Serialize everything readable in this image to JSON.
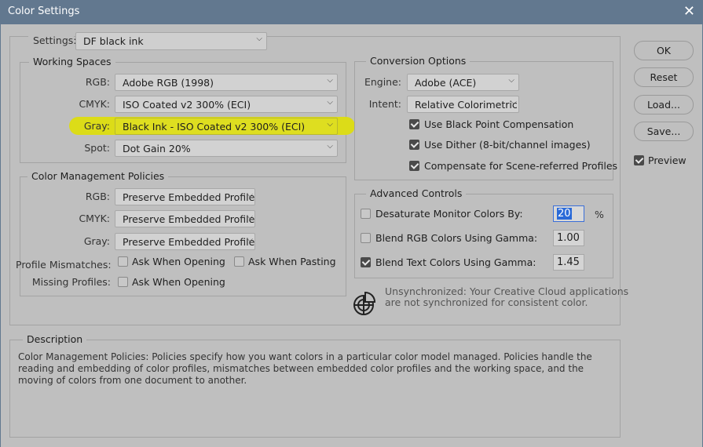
{
  "window": {
    "title": "Color Settings",
    "close_icon": "close-icon"
  },
  "settings": {
    "label": "Settings:",
    "value": "DF black ink"
  },
  "working_spaces": {
    "title": "Working Spaces",
    "rgb_label": "RGB:",
    "rgb": "Adobe RGB (1998)",
    "cmyk_label": "CMYK:",
    "cmyk": "ISO Coated v2 300% (ECI)",
    "gray_label": "Gray:",
    "gray": "Black Ink - ISO Coated v2 300% (ECI)",
    "spot_label": "Spot:",
    "spot": "Dot Gain 20%",
    "highlight_color": "#dcdc18"
  },
  "policies": {
    "title": "Color Management Policies",
    "rgb_label": "RGB:",
    "rgb": "Preserve Embedded Profiles",
    "cmyk_label": "CMYK:",
    "cmyk": "Preserve Embedded Profiles",
    "gray_label": "Gray:",
    "gray": "Preserve Embedded Profiles",
    "mismatch_label": "Profile Mismatches:",
    "ask_opening": "Ask When Opening",
    "ask_opening_checked": false,
    "ask_pasting": "Ask When Pasting",
    "ask_pasting_checked": false,
    "missing_label": "Missing Profiles:",
    "missing_ask_opening": "Ask When Opening",
    "missing_checked": false
  },
  "conversion": {
    "title": "Conversion Options",
    "engine_label": "Engine:",
    "engine": "Adobe (ACE)",
    "intent_label": "Intent:",
    "intent": "Relative Colorimetric",
    "bpc": "Use Black Point Compensation",
    "bpc_checked": true,
    "dither": "Use Dither (8-bit/channel images)",
    "dither_checked": true,
    "scene": "Compensate for Scene-referred Profiles",
    "scene_checked": true
  },
  "advanced": {
    "title": "Advanced Controls",
    "desaturate": "Desaturate Monitor Colors By:",
    "desaturate_checked": false,
    "desaturate_value": "20",
    "percent": "%",
    "blend_rgb": "Blend RGB Colors Using Gamma:",
    "blend_rgb_checked": false,
    "blend_rgb_value": "1.00",
    "blend_text": "Blend Text Colors Using Gamma:",
    "blend_text_checked": true,
    "blend_text_value": "1.45"
  },
  "sync": {
    "icon": "color-sync-icon",
    "line1": "Unsynchronized: Your Creative Cloud applications",
    "line2": "are not synchronized for consistent color."
  },
  "buttons": {
    "ok": "OK",
    "reset": "Reset",
    "load": "Load...",
    "save": "Save...",
    "preview": "Preview",
    "preview_checked": true
  },
  "description": {
    "title": "Description",
    "text": "Color Management Policies:  Policies specify how you want colors in a particular color model managed.  Policies handle the reading and embedding of color profiles, mismatches between embedded color profiles and the working space, and the moving of colors from one document to another."
  }
}
